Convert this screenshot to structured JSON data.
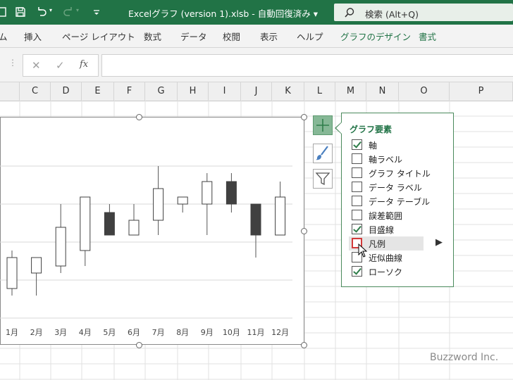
{
  "titlebar": {
    "title": "Excelグラフ (version 1).xlsb  -  自動回復済み ▾",
    "search": "検索 (Alt+Q)",
    "customize_icon": "customize-quick-access-icon"
  },
  "ribbon": {
    "tabs": [
      "ム",
      "挿入",
      "ページ レイアウト",
      "数式",
      "データ",
      "校閲",
      "表示",
      "ヘルプ",
      "グラフのデザイン",
      "書式"
    ]
  },
  "formula_bar": {
    "cancel": "✕",
    "enter": "✓",
    "fx": "fx"
  },
  "columns": [
    "C",
    "D",
    "E",
    "F",
    "G",
    "H",
    "I",
    "J",
    "K",
    "L",
    "M",
    "N",
    "O",
    "P"
  ],
  "chart_data": {
    "type": "candlestick",
    "categories": [
      "1月",
      "2月",
      "3月",
      "4月",
      "5月",
      "6月",
      "7月",
      "8月",
      "9月",
      "10月",
      "11月",
      "12月"
    ],
    "series": [
      {
        "open": [
          410,
          388,
          378,
          356,
          302,
          334,
          313,
          290,
          290,
          258,
          290,
          334
        ],
        "close": [
          366,
          366,
          323,
          280,
          334,
          313,
          268,
          280,
          258,
          290,
          334,
          280
        ],
        "high": [
          356,
          366,
          290,
          280,
          290,
          290,
          236,
          280,
          246,
          246,
          290,
          258
        ],
        "low": [
          420,
          420,
          388,
          378,
          334,
          334,
          334,
          302,
          334,
          302,
          366,
          334
        ]
      }
    ],
    "legend": "none",
    "grid": true
  },
  "flyout": {
    "title": "グラフ要素",
    "items": [
      {
        "label": "軸",
        "checked": true
      },
      {
        "label": "軸ラベル",
        "checked": false
      },
      {
        "label": "グラフ タイトル",
        "checked": false
      },
      {
        "label": "データ ラベル",
        "checked": false
      },
      {
        "label": "データ テーブル",
        "checked": false
      },
      {
        "label": "誤差範囲",
        "checked": false
      },
      {
        "label": "目盛線",
        "checked": true
      },
      {
        "label": "凡例",
        "checked": false
      },
      {
        "label": "近似曲線",
        "checked": false
      },
      {
        "label": "ローソク",
        "checked": true
      }
    ]
  },
  "watermark": "Buzzword Inc.",
  "colors": {
    "accent": "#217346",
    "down": "#404040",
    "focus": "#d23a3a"
  }
}
